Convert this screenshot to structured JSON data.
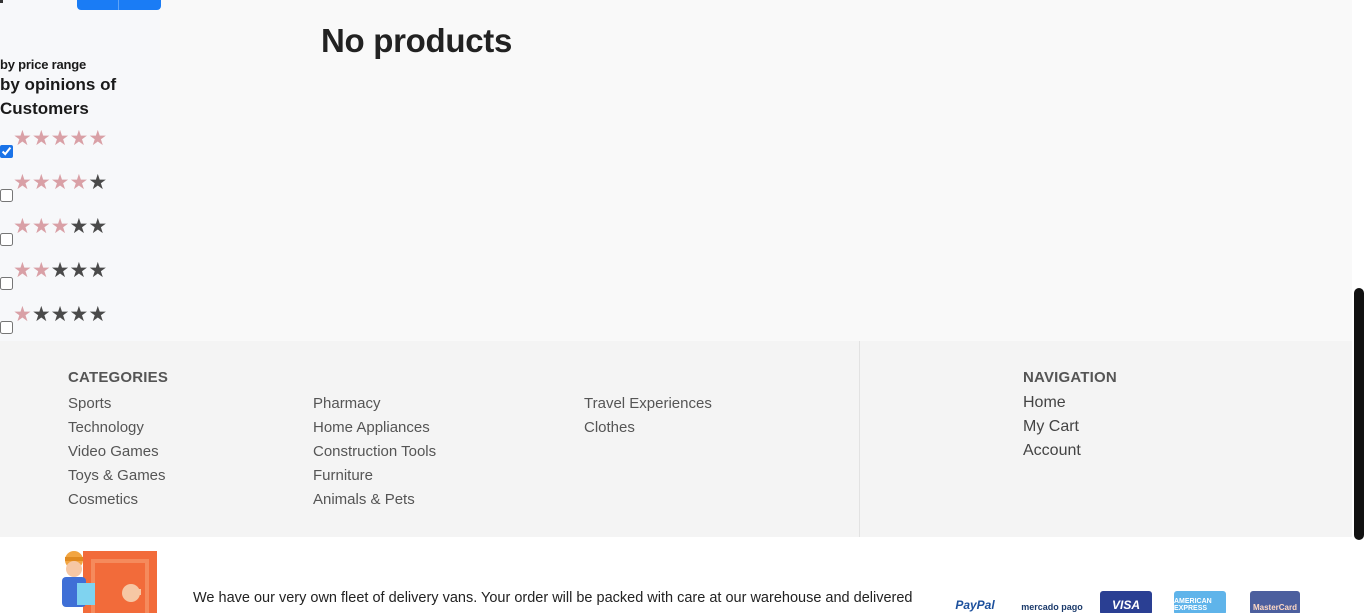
{
  "sidebar": {
    "filter_price_label": "by price range",
    "filter_opinions_label": "by opinions of Customers",
    "ratings": [
      {
        "filled": 5,
        "checked": true
      },
      {
        "filled": 4,
        "checked": false
      },
      {
        "filled": 3,
        "checked": false
      },
      {
        "filled": 2,
        "checked": false
      },
      {
        "filled": 1,
        "checked": false
      }
    ]
  },
  "main": {
    "message": "No products"
  },
  "footer": {
    "categories_title": "CATEGORIES",
    "categories_col1": [
      "Sports",
      "Technology",
      "Video Games",
      "Toys & Games",
      "Cosmetics"
    ],
    "categories_col2": [
      "Pharmacy",
      "Home Appliances",
      "Construction Tools",
      "Furniture",
      "Animals & Pets"
    ],
    "categories_col3": [
      "Travel Experiences",
      "Clothes"
    ],
    "navigation_title": "NAVIGATION",
    "navigation": [
      "Home",
      "My Cart",
      "Account"
    ]
  },
  "bottom": {
    "delivery_text": "We have our very own fleet of delivery vans. Your order will be packed with care at our warehouse and delivered",
    "payments": [
      "PayPal",
      "mercado pago",
      "VISA",
      "AMERICAN EXPRESS",
      "MasterCard"
    ]
  },
  "colors": {
    "accent": "#1a7cf5",
    "star_filled": "#d9a0a6",
    "star_empty": "#4a4a4a",
    "footer_bg": "#f4f4f4"
  }
}
